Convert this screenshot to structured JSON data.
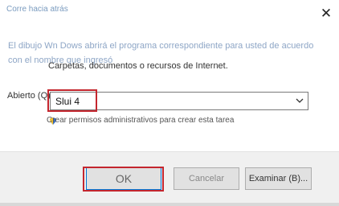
{
  "window": {
    "title": "Corre hacia atrás",
    "close_glyph": "✕"
  },
  "description": {
    "line1": "El dibujo Wn Dows abrirá el programa correspondiente para usted de acuerdo",
    "line2": "con el nombre que ingresó",
    "line3": "Carpetas, documentos o recursos de Internet."
  },
  "open_field": {
    "label": "Abierto (Q)",
    "value": "Slui 4"
  },
  "admin_note": "Crear permisos administrativos para crear esta tarea",
  "buttons": {
    "ok": "OK",
    "cancel": "Cancelar",
    "browse": "Examinar (B)..."
  },
  "colors": {
    "highlight": "#c4262e",
    "accent": "#0078d7"
  }
}
